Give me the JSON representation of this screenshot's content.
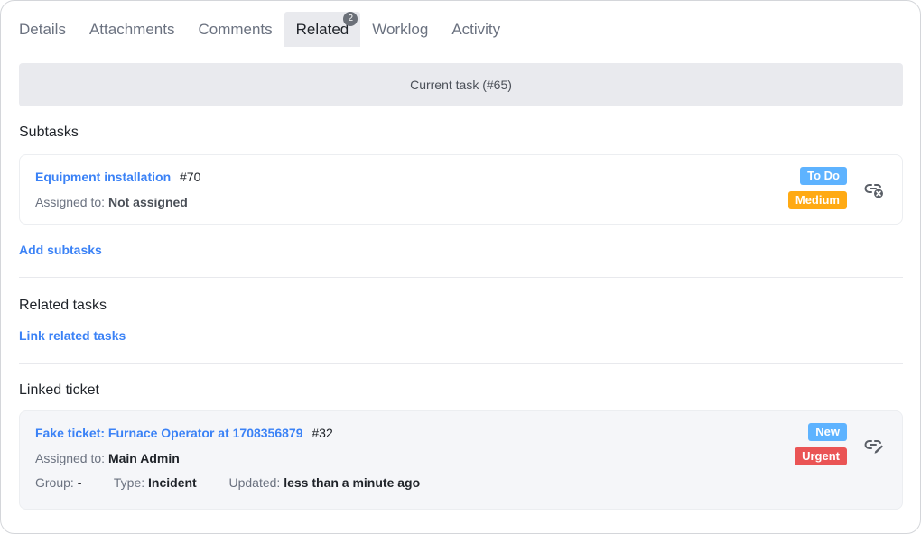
{
  "tabs": [
    {
      "label": "Details",
      "active": false
    },
    {
      "label": "Attachments",
      "active": false
    },
    {
      "label": "Comments",
      "active": false
    },
    {
      "label": "Related",
      "active": true,
      "badge": "2"
    },
    {
      "label": "Worklog",
      "active": false
    },
    {
      "label": "Activity",
      "active": false
    }
  ],
  "current_task": "Current task (#65)",
  "subtasks": {
    "heading": "Subtasks",
    "items": [
      {
        "title": "Equipment installation",
        "number": "#70",
        "assigned_label": "Assigned to:",
        "assigned_value": "Not assigned",
        "status": "To Do",
        "status_color": "#5eb3ff",
        "priority": "Medium",
        "priority_color": "#ffaa14",
        "action_icon": "unlink-icon"
      }
    ],
    "add_link": "Add subtasks"
  },
  "related_tasks": {
    "heading": "Related tasks",
    "link": "Link related tasks"
  },
  "linked_ticket": {
    "heading": "Linked ticket",
    "title": "Fake ticket: Furnace Operator at 1708356879",
    "number": "#32",
    "assigned_label": "Assigned to:",
    "assigned_value": "Main Admin",
    "group_label": "Group:",
    "group_value": "-",
    "type_label": "Type:",
    "type_value": "Incident",
    "updated_label": "Updated:",
    "updated_value": "less than a minute ago",
    "status": "New",
    "status_color": "#5eb3ff",
    "priority": "Urgent",
    "priority_color": "#ea5455",
    "action_icon": "edit-link-icon"
  }
}
